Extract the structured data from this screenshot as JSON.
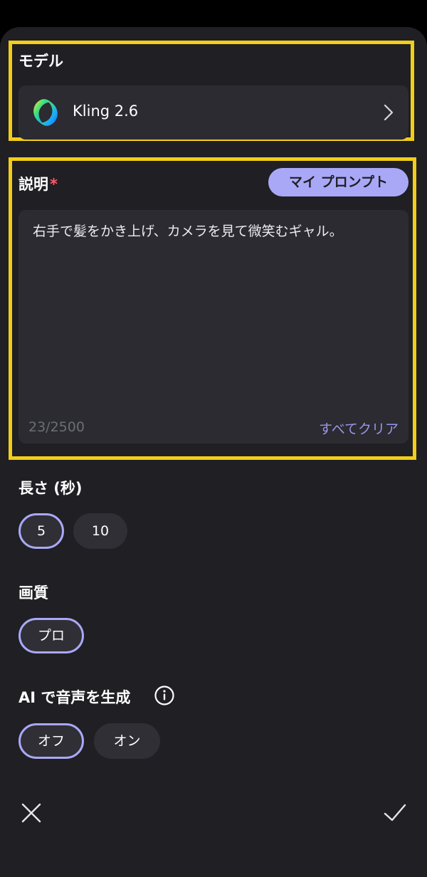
{
  "model_section": {
    "title": "モデル",
    "model_name": "Kling 2.6",
    "logo_icon": "kling-logo-icon",
    "chevron_icon": "chevron-right-icon"
  },
  "description_section": {
    "title": "説明",
    "required_mark": "*",
    "my_prompt_label": "マイ プロンプト",
    "prompt_text": "右手で髪をかき上げ、カメラを見て微笑むギャル。",
    "char_count": "23/2500",
    "clear_all_label": "すべてクリア"
  },
  "duration_section": {
    "title": "長さ (秒)",
    "options": [
      "5",
      "10"
    ],
    "selected": "5"
  },
  "quality_section": {
    "title": "画質",
    "options": [
      "プロ"
    ],
    "selected": "プロ"
  },
  "audio_section": {
    "title": "AI で音声を生成",
    "info_icon": "info-icon",
    "options": [
      "オフ",
      "オン"
    ],
    "selected": "オフ"
  },
  "footer": {
    "cancel_icon": "close-icon",
    "confirm_icon": "checkmark-icon"
  },
  "colors": {
    "background": "#1f1f24",
    "card": "#2b2b31",
    "accent": "#a9a8f7",
    "highlight": "#f2cd1a",
    "required": "#ff5b6b"
  }
}
